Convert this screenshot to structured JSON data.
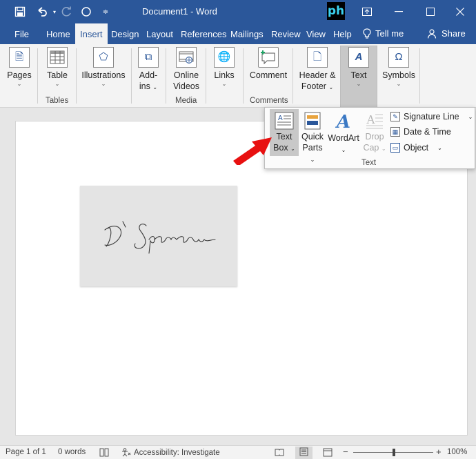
{
  "window": {
    "title": "Document1  -  Word",
    "logo_text": "ph"
  },
  "tabs": [
    {
      "label": "File"
    },
    {
      "label": "Home"
    },
    {
      "label": "Insert"
    },
    {
      "label": "Design"
    },
    {
      "label": "Layout"
    },
    {
      "label": "References"
    },
    {
      "label": "Mailings"
    },
    {
      "label": "Review"
    },
    {
      "label": "View"
    },
    {
      "label": "Help"
    }
  ],
  "tell_me": "Tell me",
  "share": "Share",
  "ribbon": {
    "pages": "Pages",
    "table": "Table",
    "illustrations": "Illustrations",
    "addins_1": "Add-",
    "addins_2": "ins",
    "online_videos_1": "Online",
    "online_videos_2": "Videos",
    "links": "Links",
    "comment": "Comment",
    "header_footer_1": "Header &",
    "header_footer_2": "Footer",
    "text": "Text",
    "symbols": "Symbols",
    "groups": {
      "tables": "Tables",
      "media": "Media",
      "comments": "Comments"
    }
  },
  "text_dropdown": {
    "text_box_1": "Text",
    "text_box_2": "Box",
    "quick_parts_1": "Quick",
    "quick_parts_2": "Parts",
    "wordart": "WordArt",
    "drop_cap_1": "Drop",
    "drop_cap_2": "Cap",
    "signature_line": "Signature Line",
    "date_time": "Date & Time",
    "object": "Object",
    "group_label": "Text"
  },
  "document": {
    "signature_text": "D' Sparrow"
  },
  "status": {
    "page": "Page 1 of 1",
    "words": "0 words",
    "accessibility": "Accessibility: Investigate",
    "zoom": "100%"
  },
  "colors": {
    "title_bar": "#2b579a",
    "ribbon_bg": "#f3f3f3",
    "arrow": "#e81010"
  },
  "icons": [
    "save-icon",
    "undo-icon",
    "redo-icon",
    "autosave-icon",
    "customize-icon",
    "ribbon-display-icon",
    "minimize-icon",
    "maximize-icon",
    "close-icon",
    "lightbulb-icon",
    "share-person-icon"
  ]
}
